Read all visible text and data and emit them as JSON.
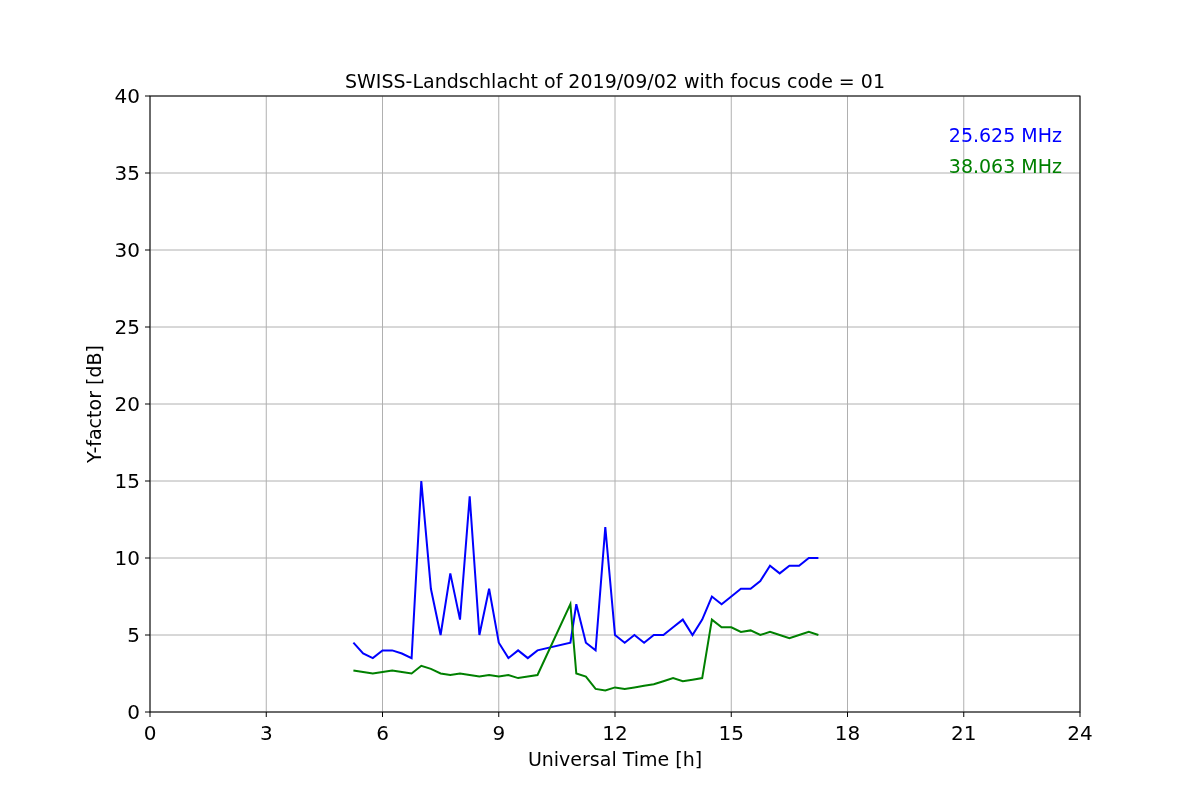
{
  "chart_data": {
    "type": "line",
    "title": "SWISS-Landschlacht of 2019/09/02 with focus code = 01",
    "xlabel": "Universal Time [h]",
    "ylabel": "Y-factor [dB]",
    "x": [
      5.25,
      5.5,
      5.75,
      6,
      6.25,
      6.5,
      6.75,
      7,
      7.25,
      7.5,
      7.75,
      8,
      8.25,
      8.5,
      8.75,
      9,
      9.25,
      9.5,
      9.75,
      10,
      10.85,
      11,
      11.25,
      11.5,
      11.75,
      12,
      12.25,
      12.5,
      12.75,
      13,
      13.25,
      13.5,
      13.75,
      14,
      14.25,
      14.5,
      14.75,
      15,
      15.25,
      15.5,
      15.75,
      16,
      16.25,
      16.5,
      16.75,
      17,
      17.25
    ],
    "series": [
      {
        "name": "25.625 MHz",
        "color": "#0000ff",
        "values": [
          4.5,
          3.8,
          3.5,
          4,
          4,
          3.8,
          3.5,
          15,
          8,
          5,
          9,
          6,
          14,
          5,
          8,
          4.5,
          3.5,
          4,
          3.5,
          4,
          4.5,
          7,
          4.5,
          4,
          12,
          5,
          4.5,
          5,
          4.5,
          5,
          5,
          5.5,
          6,
          5,
          6,
          7.5,
          7,
          7.5,
          8,
          8,
          8.5,
          9.5,
          9,
          9.5,
          9.5,
          10,
          10
        ]
      },
      {
        "name": "38.063 MHz",
        "color": "#008000",
        "values": [
          2.7,
          2.6,
          2.5,
          2.6,
          2.7,
          2.6,
          2.5,
          3,
          2.8,
          2.5,
          2.4,
          2.5,
          2.4,
          2.3,
          2.4,
          2.3,
          2.4,
          2.2,
          2.3,
          2.4,
          7,
          2.5,
          2.3,
          1.5,
          1.4,
          1.6,
          1.5,
          1.6,
          1.7,
          1.8,
          2,
          2.2,
          2,
          2.1,
          2.2,
          6,
          5.5,
          5.5,
          5.2,
          5.3,
          5,
          5.2,
          5,
          4.8,
          5,
          5.2,
          5
        ]
      }
    ],
    "xlim": [
      0,
      24
    ],
    "ylim": [
      0,
      40
    ],
    "xticks": [
      0,
      3,
      6,
      9,
      12,
      15,
      18,
      21,
      24
    ],
    "yticks": [
      0,
      5,
      10,
      15,
      20,
      25,
      30,
      35,
      40
    ],
    "grid": true
  }
}
